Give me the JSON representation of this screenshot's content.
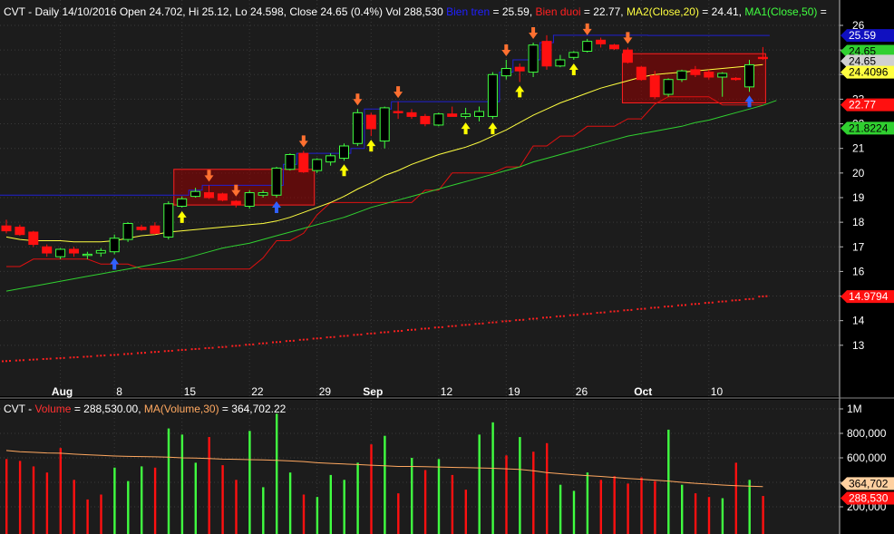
{
  "header": {
    "price": [
      {
        "text": "CVT - Daily 14/10/2016 Open 24.702, Hi 25.12, Lo 24.598, Close 24.65 (0.4%) Vol 288,530 ",
        "color": "#ffffff"
      },
      {
        "text": "Bien tren",
        "color": "#2020ff"
      },
      {
        "text": " = 25.59, ",
        "color": "#ffffff"
      },
      {
        "text": "Bien duoi",
        "color": "#ff2020"
      },
      {
        "text": " = 22.77, ",
        "color": "#ffffff"
      },
      {
        "text": "MA2(Close,20)",
        "color": "#ffff40"
      },
      {
        "text": " = 24.41, ",
        "color": "#ffffff"
      },
      {
        "text": "MA1(Close,50)",
        "color": "#40ff40"
      },
      {
        "text": " =",
        "color": "#ffffff"
      }
    ],
    "volume": [
      {
        "text": "CVT - ",
        "color": "#ffffff"
      },
      {
        "text": "Volume",
        "color": "#ff3030"
      },
      {
        "text": " = 288,530.00, ",
        "color": "#ffffff"
      },
      {
        "text": "MA(Volume,30)",
        "color": "#ffa860"
      },
      {
        "text": " = 364,702.22",
        "color": "#ffffff"
      }
    ]
  },
  "colors": {
    "background": "#000000",
    "panel": "#1c1c1c",
    "grid": "#3a3a3a",
    "up": "#40ff40",
    "down": "#ff1010",
    "ma20": "#ffff40",
    "ma50": "#30d030",
    "upper_band": "#2020d0",
    "lower_band": "#e01010",
    "sar": "#ff2020",
    "vol_ma": "#ffa860",
    "arrow_buy": "#ffff00",
    "arrow_sell": "#ff7030",
    "arrow_blue": "#3060ff"
  },
  "chart_data": [
    {
      "type": "candlestick",
      "ylim": [
        12,
        26.5
      ],
      "yticks": [
        13,
        14,
        15,
        16,
        17,
        18,
        19,
        20,
        21,
        22,
        23,
        24,
        25,
        26
      ],
      "xlabels": [
        {
          "i": 4,
          "label": "Aug"
        },
        {
          "i": 8,
          "label": "8"
        },
        {
          "i": 13,
          "label": "15"
        },
        {
          "i": 18,
          "label": "22"
        },
        {
          "i": 23,
          "label": "29"
        },
        {
          "i": 27,
          "label": "Sep"
        },
        {
          "i": 32,
          "label": "12"
        },
        {
          "i": 37,
          "label": "19"
        },
        {
          "i": 42,
          "label": "26"
        },
        {
          "i": 47,
          "label": "Oct"
        },
        {
          "i": 52,
          "label": "10"
        }
      ],
      "candles": [
        {
          "o": 17.85,
          "h": 18.1,
          "l": 17.55,
          "c": 17.65
        },
        {
          "o": 17.8,
          "h": 17.9,
          "l": 17.45,
          "c": 17.5
        },
        {
          "o": 17.6,
          "h": 17.65,
          "l": 17.0,
          "c": 17.1
        },
        {
          "o": 17.0,
          "h": 17.1,
          "l": 16.6,
          "c": 16.75
        },
        {
          "o": 16.6,
          "h": 16.95,
          "l": 16.5,
          "c": 16.9
        },
        {
          "o": 16.9,
          "h": 17.0,
          "l": 16.6,
          "c": 16.75
        },
        {
          "o": 16.65,
          "h": 16.8,
          "l": 16.5,
          "c": 16.7
        },
        {
          "o": 16.75,
          "h": 16.95,
          "l": 16.6,
          "c": 16.85
        },
        {
          "o": 16.8,
          "h": 17.5,
          "l": 16.7,
          "c": 17.35
        },
        {
          "o": 17.3,
          "h": 18.0,
          "l": 17.2,
          "c": 17.95
        },
        {
          "o": 17.8,
          "h": 17.9,
          "l": 17.65,
          "c": 17.7
        },
        {
          "o": 17.85,
          "h": 18.0,
          "l": 17.5,
          "c": 17.55
        },
        {
          "o": 17.4,
          "h": 18.85,
          "l": 17.3,
          "c": 18.75
        },
        {
          "o": 18.65,
          "h": 19.05,
          "l": 18.6,
          "c": 18.95
        },
        {
          "o": 19.05,
          "h": 19.4,
          "l": 19.0,
          "c": 19.25
        },
        {
          "o": 19.2,
          "h": 19.5,
          "l": 18.95,
          "c": 19.0
        },
        {
          "o": 19.15,
          "h": 19.2,
          "l": 18.85,
          "c": 18.9
        },
        {
          "o": 18.85,
          "h": 18.9,
          "l": 18.6,
          "c": 18.7
        },
        {
          "o": 18.65,
          "h": 19.3,
          "l": 18.55,
          "c": 19.2
        },
        {
          "o": 19.1,
          "h": 19.3,
          "l": 19.0,
          "c": 19.2
        },
        {
          "o": 19.1,
          "h": 20.25,
          "l": 19.0,
          "c": 20.2
        },
        {
          "o": 20.15,
          "h": 20.8,
          "l": 20.1,
          "c": 20.75
        },
        {
          "o": 20.8,
          "h": 20.9,
          "l": 20.0,
          "c": 20.05
        },
        {
          "o": 20.1,
          "h": 20.6,
          "l": 20.0,
          "c": 20.55
        },
        {
          "o": 20.45,
          "h": 20.8,
          "l": 20.3,
          "c": 20.7
        },
        {
          "o": 20.6,
          "h": 21.2,
          "l": 20.5,
          "c": 21.1
        },
        {
          "o": 21.2,
          "h": 22.6,
          "l": 21.1,
          "c": 22.45
        },
        {
          "o": 22.35,
          "h": 22.45,
          "l": 21.5,
          "c": 21.8
        },
        {
          "o": 21.3,
          "h": 22.7,
          "l": 21.0,
          "c": 22.65
        },
        {
          "o": 22.5,
          "h": 22.9,
          "l": 22.2,
          "c": 22.45
        },
        {
          "o": 22.45,
          "h": 22.6,
          "l": 22.2,
          "c": 22.3
        },
        {
          "o": 22.3,
          "h": 22.4,
          "l": 21.9,
          "c": 22.0
        },
        {
          "o": 21.95,
          "h": 22.45,
          "l": 21.9,
          "c": 22.4
        },
        {
          "o": 22.4,
          "h": 22.7,
          "l": 22.3,
          "c": 22.3
        },
        {
          "o": 22.3,
          "h": 22.65,
          "l": 22.2,
          "c": 22.4
        },
        {
          "o": 22.3,
          "h": 22.7,
          "l": 22.1,
          "c": 22.5
        },
        {
          "o": 22.3,
          "h": 24.1,
          "l": 22.2,
          "c": 24.0
        },
        {
          "o": 23.95,
          "h": 24.6,
          "l": 23.8,
          "c": 24.25
        },
        {
          "o": 24.3,
          "h": 24.45,
          "l": 23.7,
          "c": 24.15
        },
        {
          "o": 24.1,
          "h": 25.3,
          "l": 23.9,
          "c": 25.2
        },
        {
          "o": 25.35,
          "h": 25.6,
          "l": 24.2,
          "c": 24.35
        },
        {
          "o": 24.35,
          "h": 24.8,
          "l": 24.3,
          "c": 24.6
        },
        {
          "o": 24.7,
          "h": 24.95,
          "l": 24.6,
          "c": 24.9
        },
        {
          "o": 24.95,
          "h": 25.45,
          "l": 24.9,
          "c": 25.35
        },
        {
          "o": 25.4,
          "h": 25.5,
          "l": 25.1,
          "c": 25.25
        },
        {
          "o": 25.2,
          "h": 25.25,
          "l": 25.0,
          "c": 25.05
        },
        {
          "o": 25.0,
          "h": 25.1,
          "l": 24.45,
          "c": 24.5
        },
        {
          "o": 24.3,
          "h": 24.35,
          "l": 23.75,
          "c": 23.8
        },
        {
          "o": 23.95,
          "h": 24.15,
          "l": 23.0,
          "c": 23.1
        },
        {
          "o": 23.2,
          "h": 23.85,
          "l": 23.1,
          "c": 23.8
        },
        {
          "o": 23.8,
          "h": 24.2,
          "l": 23.7,
          "c": 24.15
        },
        {
          "o": 24.2,
          "h": 24.35,
          "l": 23.9,
          "c": 24.0
        },
        {
          "o": 24.1,
          "h": 24.2,
          "l": 23.8,
          "c": 23.9
        },
        {
          "o": 23.9,
          "h": 24.1,
          "l": 23.1,
          "c": 24.05
        },
        {
          "o": 23.85,
          "h": 23.9,
          "l": 23.75,
          "c": 23.8
        },
        {
          "o": 23.5,
          "h": 24.6,
          "l": 23.3,
          "c": 24.4
        },
        {
          "o": 24.7,
          "h": 25.12,
          "l": 24.598,
          "c": 24.65
        }
      ],
      "ma20": [
        17.4,
        17.3,
        17.25,
        17.25,
        17.25,
        17.2,
        17.2,
        17.2,
        17.25,
        17.35,
        17.45,
        17.5,
        17.6,
        17.65,
        17.7,
        17.75,
        17.8,
        17.85,
        17.9,
        17.95,
        18.05,
        18.2,
        18.4,
        18.6,
        18.8,
        19.05,
        19.35,
        19.6,
        19.9,
        20.1,
        20.35,
        20.55,
        20.75,
        20.9,
        21.05,
        21.25,
        21.5,
        21.75,
        22.05,
        22.35,
        22.6,
        22.85,
        23.05,
        23.25,
        23.45,
        23.6,
        23.75,
        23.9,
        24.0,
        24.05,
        24.1,
        24.15,
        24.2,
        24.25,
        24.3,
        24.35,
        24.41
      ],
      "ma50": [
        15.2,
        15.3,
        15.4,
        15.5,
        15.6,
        15.7,
        15.8,
        15.9,
        16.0,
        16.1,
        16.2,
        16.3,
        16.4,
        16.5,
        16.65,
        16.8,
        16.95,
        17.05,
        17.15,
        17.3,
        17.45,
        17.6,
        17.75,
        17.9,
        18.05,
        18.2,
        18.4,
        18.6,
        18.75,
        18.9,
        19.05,
        19.2,
        19.35,
        19.5,
        19.65,
        19.8,
        19.95,
        20.1,
        20.25,
        20.45,
        20.6,
        20.75,
        20.9,
        21.05,
        21.2,
        21.35,
        21.5,
        21.6,
        21.7,
        21.8,
        21.9,
        22.05,
        22.15,
        22.3,
        22.45,
        22.6,
        22.75,
        22.95
      ],
      "upper_band": [
        19.1,
        19.1,
        19.1,
        19.1,
        19.1,
        19.1,
        19.1,
        19.1,
        19.1,
        19.1,
        19.1,
        19.1,
        19.1,
        19.1,
        19.3,
        19.5,
        19.5,
        19.5,
        19.5,
        19.5,
        19.5,
        20.35,
        20.8,
        20.8,
        20.8,
        20.8,
        21.0,
        22.6,
        22.6,
        22.9,
        22.9,
        22.9,
        22.9,
        22.9,
        22.9,
        22.9,
        22.9,
        24.1,
        24.6,
        24.6,
        25.3,
        25.6,
        25.6,
        25.6,
        25.6,
        25.6,
        25.6,
        25.6,
        25.59,
        25.59,
        25.59,
        25.59,
        25.59,
        25.59,
        25.59,
        25.59,
        25.59
      ],
      "lower_band": [
        16.2,
        16.2,
        16.5,
        16.5,
        16.5,
        16.5,
        16.5,
        16.3,
        16.3,
        16.3,
        16.1,
        16.1,
        16.1,
        16.1,
        16.1,
        16.1,
        16.1,
        16.1,
        16.1,
        16.55,
        17.25,
        17.25,
        17.55,
        18.3,
        18.8,
        18.8,
        18.8,
        18.8,
        18.8,
        18.8,
        18.8,
        19.3,
        19.3,
        20.0,
        20.0,
        20.0,
        20.0,
        20.25,
        20.25,
        21.1,
        21.1,
        21.5,
        21.5,
        21.9,
        21.9,
        21.9,
        22.2,
        22.2,
        22.8,
        23.1,
        23.1,
        23.1,
        23.1,
        22.77,
        22.77,
        22.77,
        22.77
      ],
      "sar": [
        12.35,
        12.38,
        12.41,
        12.44,
        12.47,
        12.5,
        12.53,
        12.57,
        12.6,
        12.64,
        12.68,
        12.72,
        12.76,
        12.8,
        12.84,
        12.88,
        12.92,
        12.97,
        13.02,
        13.07,
        13.12,
        13.17,
        13.22,
        13.27,
        13.32,
        13.37,
        13.42,
        13.47,
        13.52,
        13.57,
        13.62,
        13.67,
        13.72,
        13.77,
        13.82,
        13.87,
        13.92,
        13.97,
        14.02,
        14.07,
        14.12,
        14.17,
        14.22,
        14.27,
        14.32,
        14.37,
        14.42,
        14.47,
        14.52,
        14.57,
        14.62,
        14.67,
        14.72,
        14.77,
        14.82,
        14.87,
        14.9794
      ],
      "boxes": [
        {
          "i0": 12.4,
          "i1": 22.8,
          "top": 20.15,
          "bottom": 18.7
        },
        {
          "i0": 45.6,
          "i1": 56.2,
          "top": 24.85,
          "bottom": 22.85
        }
      ],
      "arrows": [
        {
          "i": 8,
          "kind": "blue-up"
        },
        {
          "i": 13,
          "kind": "buy"
        },
        {
          "i": 15,
          "kind": "sell"
        },
        {
          "i": 17,
          "kind": "sell"
        },
        {
          "i": 20,
          "kind": "blue-up"
        },
        {
          "i": 22,
          "kind": "sell"
        },
        {
          "i": 25,
          "kind": "buy"
        },
        {
          "i": 26,
          "kind": "sell"
        },
        {
          "i": 27,
          "kind": "buy"
        },
        {
          "i": 29,
          "kind": "sell"
        },
        {
          "i": 34,
          "kind": "buy"
        },
        {
          "i": 36,
          "kind": "buy"
        },
        {
          "i": 37,
          "kind": "sell"
        },
        {
          "i": 38,
          "kind": "buy"
        },
        {
          "i": 39,
          "kind": "sell"
        },
        {
          "i": 42,
          "kind": "buy"
        },
        {
          "i": 43,
          "kind": "sell"
        },
        {
          "i": 46,
          "kind": "sell"
        },
        {
          "i": 55,
          "kind": "blue-up"
        }
      ],
      "price_labels": [
        {
          "value": 25.59,
          "text": "25.59",
          "bg": "#1010c0",
          "fg": "#ffffff"
        },
        {
          "value": 24.95,
          "text": "24.65",
          "bg": "#30d030",
          "fg": "#000000"
        },
        {
          "value": 24.55,
          "text": "24.65",
          "bg": "#d0d0d0",
          "fg": "#000000"
        },
        {
          "value": 24.1,
          "text": "24.4096",
          "bg": "#ffff40",
          "fg": "#000000"
        },
        {
          "value": 22.77,
          "text": "22.77",
          "bg": "#ff1010",
          "fg": "#ffffff"
        },
        {
          "value": 21.8224,
          "text": "21.8224",
          "bg": "#30d030",
          "fg": "#000000"
        },
        {
          "value": 14.9794,
          "text": "14.9794",
          "bg": "#ff1010",
          "fg": "#ffffff"
        }
      ]
    },
    {
      "type": "bar",
      "ylim": [
        50000,
        1000000
      ],
      "yticks": [
        {
          "v": 200000,
          "label": "200,000"
        },
        {
          "v": 400000,
          "label": "400,000"
        },
        {
          "v": 600000,
          "label": "600,000"
        },
        {
          "v": 800000,
          "label": "800,000"
        },
        {
          "v": 1000000,
          "label": "1M"
        }
      ],
      "values": [
        590000,
        575000,
        530000,
        480000,
        680000,
        420000,
        260000,
        300000,
        520000,
        410000,
        530000,
        520000,
        840000,
        790000,
        560000,
        770000,
        540000,
        420000,
        820000,
        360000,
        960000,
        480000,
        300000,
        280000,
        460000,
        420000,
        560000,
        710000,
        780000,
        310000,
        600000,
        500000,
        590000,
        460000,
        340000,
        790000,
        890000,
        620000,
        770000,
        650000,
        720000,
        380000,
        330000,
        480000,
        420000,
        450000,
        390000,
        440000,
        410000,
        830000,
        380000,
        310000,
        280000,
        270000,
        560000,
        420000,
        288530
      ],
      "up": [
        false,
        false,
        false,
        false,
        false,
        false,
        false,
        false,
        true,
        true,
        true,
        false,
        true,
        true,
        true,
        false,
        false,
        false,
        true,
        true,
        true,
        true,
        false,
        true,
        true,
        true,
        true,
        false,
        true,
        false,
        true,
        false,
        true,
        false,
        false,
        true,
        true,
        false,
        true,
        false,
        false,
        true,
        true,
        true,
        false,
        false,
        false,
        false,
        false,
        true,
        true,
        false,
        false,
        true,
        false,
        true,
        false
      ],
      "ma30": [
        660000,
        650000,
        645000,
        640000,
        638000,
        630000,
        625000,
        620000,
        615000,
        612000,
        610000,
        608000,
        605000,
        600000,
        598000,
        595000,
        590000,
        588000,
        585000,
        583000,
        580000,
        575000,
        570000,
        560000,
        555000,
        550000,
        545000,
        540000,
        535000,
        530000,
        530000,
        528000,
        525000,
        522000,
        520000,
        518000,
        515000,
        510000,
        505000,
        495000,
        480000,
        470000,
        462000,
        455000,
        448000,
        440000,
        432000,
        425000,
        418000,
        410000,
        400000,
        392000,
        385000,
        378000,
        372000,
        368000,
        364702
      ],
      "price_labels": [
        {
          "value": 390000,
          "text": "364,702",
          "bg": "#ffd0a0",
          "fg": "#000000"
        },
        {
          "value": 270000,
          "text": "288,530",
          "bg": "#ff1010",
          "fg": "#ffffff"
        }
      ]
    }
  ]
}
